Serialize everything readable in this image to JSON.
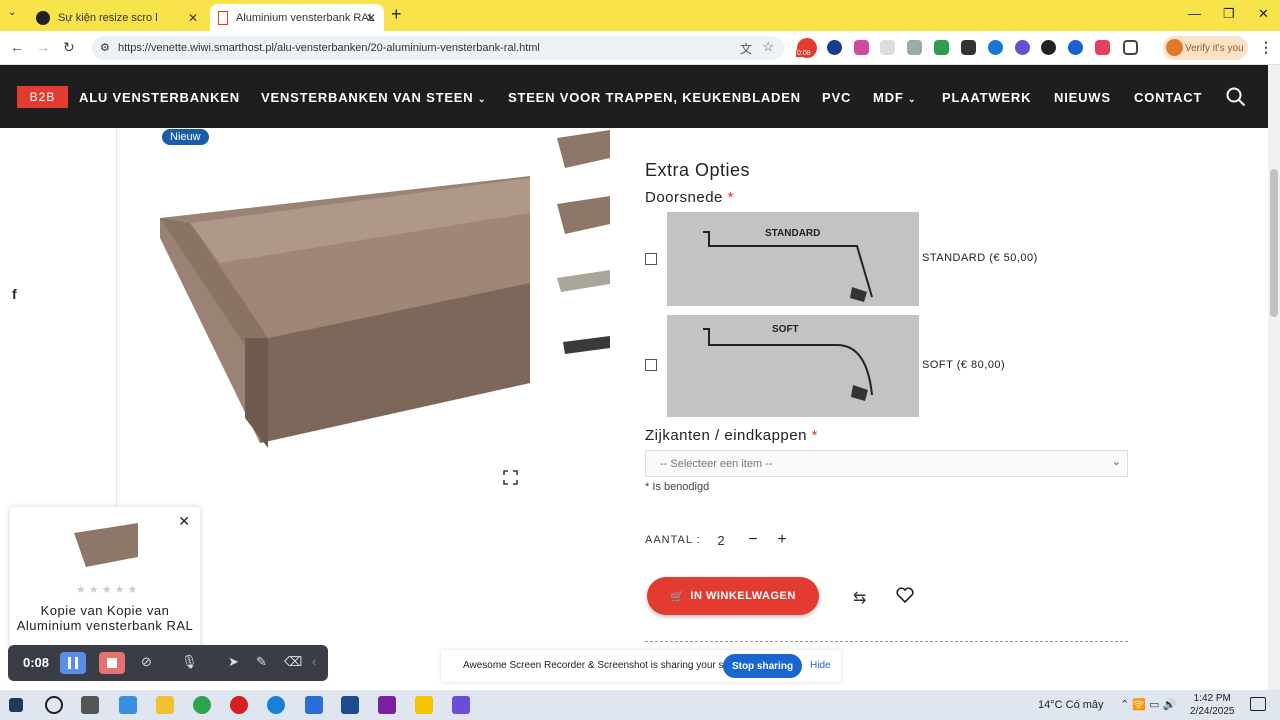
{
  "browser": {
    "tabs": [
      {
        "title": "Sự kiện resize scro l",
        "active": false
      },
      {
        "title": "Aluminium vensterbank RAL",
        "active": true
      }
    ],
    "new_tab": "+",
    "url": "https://venette.wiwi.smarthost.pl/alu-vensterbanken/20-aluminium-vensterbank-ral.html",
    "profile_label": "Verify it's you",
    "ext_badge": "0:08"
  },
  "site": {
    "b2b": "B2B",
    "nav": [
      "ALU VENSTERBANKEN",
      "VENSTERBANKEN VAN STEEN",
      "STEEN VOOR TRAPPEN, KEUKENBLADEN",
      "PVC",
      "MDF",
      "PLAATWERK",
      "NIEUWS",
      "CONTACT"
    ]
  },
  "product": {
    "badge": "Nieuw",
    "extra_title": "Extra Opties",
    "doorsnede_label": "Doorsnede",
    "req_mark": "*",
    "options": [
      {
        "img_label": "STANDARD",
        "text": "STANDARD (€ 50,00)"
      },
      {
        "img_label": "SOFT",
        "text": "SOFT (€ 80,00)"
      }
    ],
    "zijkanten_label": "Zijkanten / eindkappen",
    "select_placeholder": "-- Selecteer een item --",
    "required_hint": "* Is benodigd",
    "qty_label": "AANTAL :",
    "qty_value": "2",
    "minus": "−",
    "plus": "+",
    "cart_button": "IN WINKELWAGEN"
  },
  "popup": {
    "title": "Kopie van Kopie van Aluminium vensterbank RAL",
    "stars": "★★★★★"
  },
  "recorder": {
    "time": "0:08",
    "share_text": "Awesome Screen Recorder & Screenshot is sharing your screen.",
    "stop_label": "Stop sharing",
    "hide_label": "Hide"
  },
  "taskbar": {
    "weather": "14°C  Có mây",
    "time": "1:42 PM",
    "date": "2/24/2025"
  },
  "colors": {
    "accent": "#e33b30",
    "nav_bg": "#1e1e1e",
    "tabbar_bg": "#f8e44a",
    "badge_blue": "#1a5ea8"
  }
}
